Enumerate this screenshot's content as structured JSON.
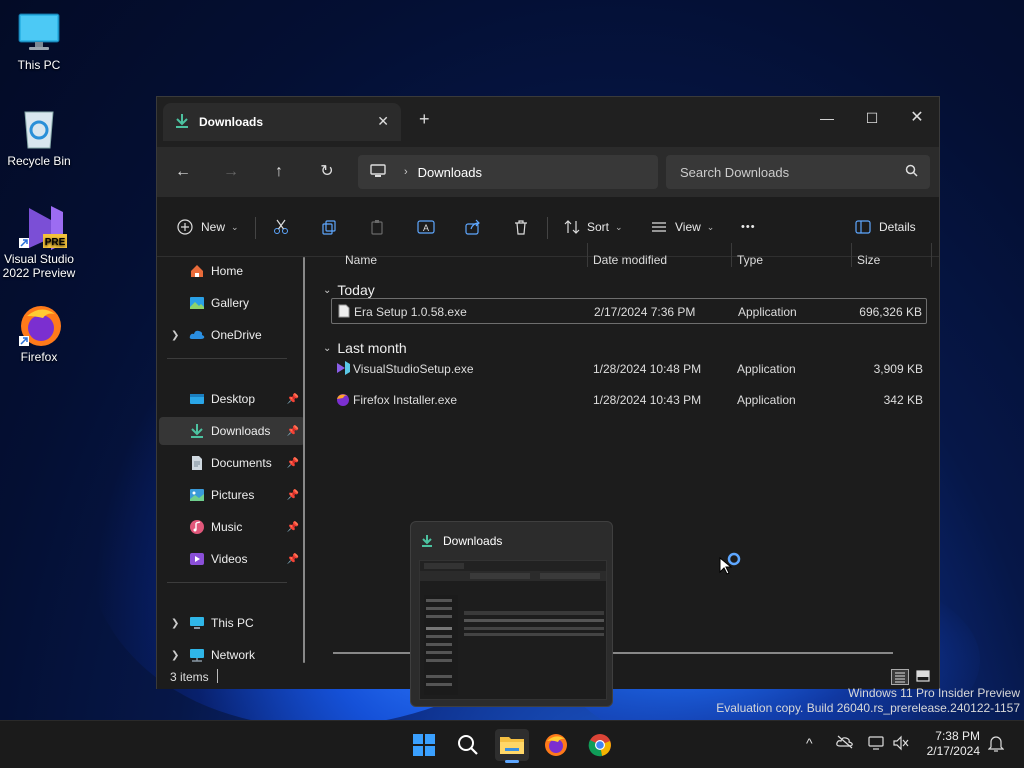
{
  "desktop": {
    "icons": [
      {
        "label": "This PC"
      },
      {
        "label": "Recycle Bin"
      },
      {
        "label": "Visual Studio 2022 Preview",
        "badge": "PRE"
      },
      {
        "label": "Firefox"
      }
    ]
  },
  "window": {
    "tab_title": "Downloads",
    "address_path": "Downloads",
    "search_placeholder": "Search Downloads",
    "toolbar": {
      "new_label": "New",
      "sort_label": "Sort",
      "view_label": "View",
      "more_label": "•••",
      "details_label": "Details"
    },
    "sidebar": {
      "home": "Home",
      "gallery": "Gallery",
      "onedrive": "OneDrive",
      "desktop": "Desktop",
      "downloads": "Downloads",
      "documents": "Documents",
      "pictures": "Pictures",
      "music": "Music",
      "videos": "Videos",
      "thispc": "This PC",
      "network": "Network"
    },
    "columns": {
      "name": "Name",
      "date": "Date modified",
      "type": "Type",
      "size": "Size"
    },
    "groups": {
      "today": "Today",
      "lastmonth": "Last month"
    },
    "files": [
      {
        "name": "Era Setup 1.0.58.exe",
        "date": "2/17/2024 7:36 PM",
        "type": "Application",
        "size": "696,326 KB"
      },
      {
        "name": "VisualStudioSetup.exe",
        "date": "1/28/2024 10:48 PM",
        "type": "Application",
        "size": "3,909 KB"
      },
      {
        "name": "Firefox Installer.exe",
        "date": "1/28/2024 10:43 PM",
        "type": "Application",
        "size": "342 KB"
      }
    ],
    "status": "3 items"
  },
  "thumbnail": {
    "title": "Downloads"
  },
  "watermark": {
    "line1": "Windows 11 Pro Insider Preview",
    "line2": "Evaluation copy. Build 26040.rs_prerelease.240122-1157"
  },
  "taskbar": {
    "time": "7:38 PM",
    "date": "2/17/2024"
  },
  "colors": {
    "accent": "#5ea7ff",
    "download_green": "#4cc2a0"
  }
}
